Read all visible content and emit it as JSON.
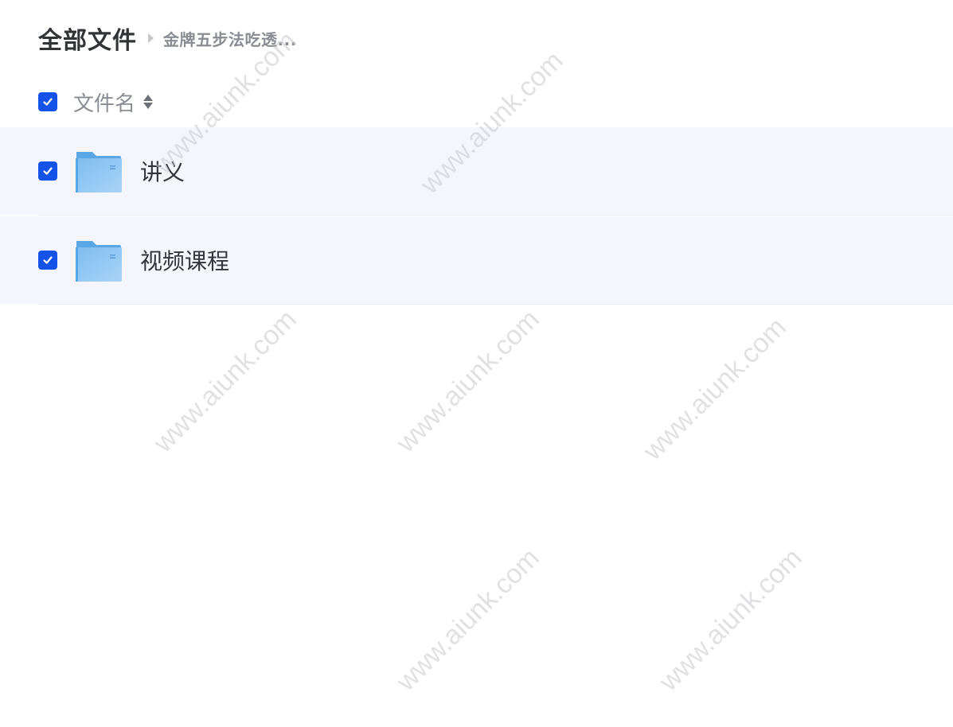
{
  "breadcrumb": {
    "root": "全部文件",
    "current": "金牌五步法吃透..."
  },
  "header": {
    "select_all_checked": true,
    "column_label": "文件名",
    "sort_icon": "sort-icon"
  },
  "files": [
    {
      "name": "讲义",
      "type": "folder",
      "checked": true,
      "icon": "folder-icon"
    },
    {
      "name": "视频课程",
      "type": "folder",
      "checked": true,
      "icon": "folder-icon"
    }
  ],
  "watermark_text": "www.aiunk.com",
  "colors": {
    "accent": "#1552e8",
    "row_selected_bg": "#f5f6fb",
    "folder": "#6fb3ec"
  }
}
